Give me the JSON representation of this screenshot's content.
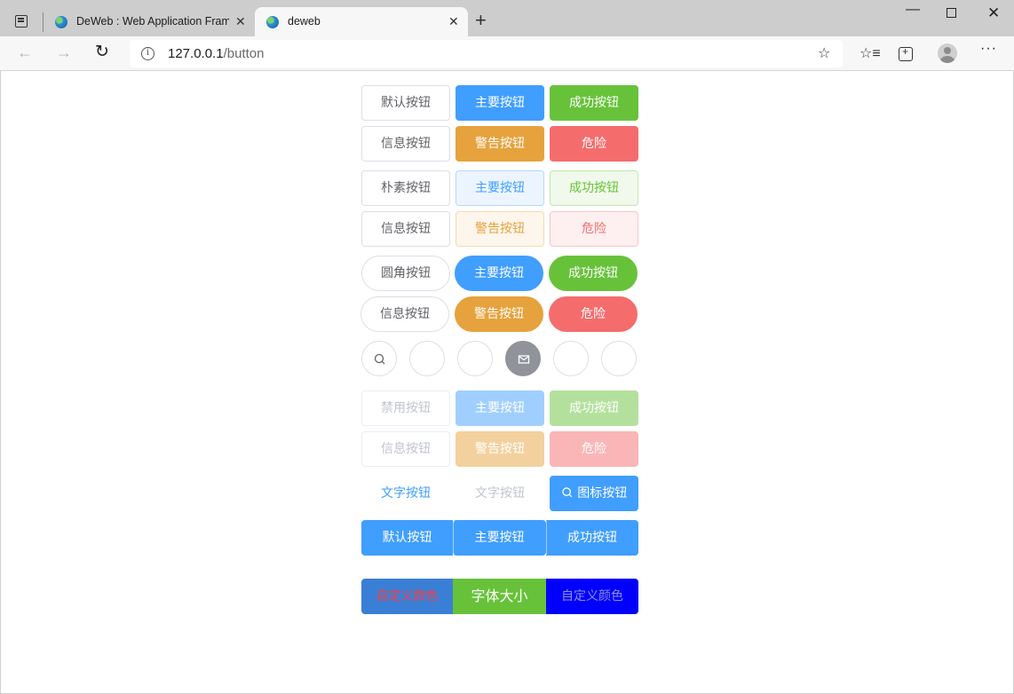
{
  "browser": {
    "tabs": [
      {
        "title": "DeWeb : Web Application Frame"
      },
      {
        "title": "deweb"
      }
    ],
    "address": {
      "host": "127.0.0.1",
      "path": "/button"
    }
  },
  "buttons": {
    "default_row1": [
      "默认按钮",
      "主要按钮",
      "成功按钮"
    ],
    "default_row2": [
      "信息按钮",
      "警告按钮",
      "危险"
    ],
    "plain_row1": [
      "朴素按钮",
      "主要按钮",
      "成功按钮"
    ],
    "plain_row2": [
      "信息按钮",
      "警告按钮",
      "危险"
    ],
    "round_row1": [
      "圆角按钮",
      "主要按钮",
      "成功按钮"
    ],
    "round_row2": [
      "信息按钮",
      "警告按钮",
      "危险"
    ],
    "circle_icons": [
      "search-icon",
      "edit-icon",
      "check-icon",
      "message-icon",
      "star-icon",
      "delete-icon"
    ],
    "disabled_row1": [
      "禁用按钮",
      "主要按钮",
      "成功按钮"
    ],
    "disabled_row2": [
      "信息按钮",
      "警告按钮",
      "危险"
    ],
    "text_row": [
      "文字按钮",
      "文字按钮",
      "图标按钮"
    ],
    "group_row": [
      "默认按钮",
      "主要按钮",
      "成功按钮"
    ],
    "custom_row": [
      "自定义颜色",
      "字体大小",
      "自定义颜色"
    ]
  },
  "colors": {
    "primary": "#409eff",
    "success": "#67c23a",
    "info": "#909399",
    "warning": "#e6a23c",
    "danger": "#f56c6c"
  }
}
